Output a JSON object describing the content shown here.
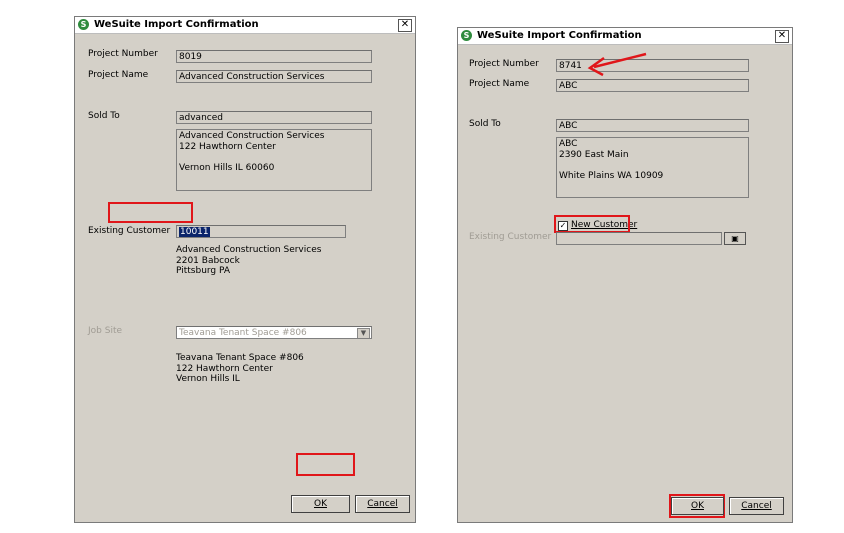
{
  "left": {
    "title": "WeSuite Import Confirmation",
    "close": "✕",
    "project_number_label": "Project Number",
    "project_number": "8019",
    "project_name_label": "Project Name",
    "project_name": "Advanced Construction Services",
    "sold_to_label": "Sold To",
    "sold_to": "advanced",
    "sold_to_address": [
      "Advanced Construction Services",
      "122 Hawthorn Center",
      "",
      "Vernon Hills IL 60060"
    ],
    "existing_customer_label": "Existing Customer",
    "existing_customer": "10011",
    "existing_customer_address": [
      "Advanced Construction Services",
      "2201 Babcock",
      "Pittsburg PA"
    ],
    "job_site_label": "Job Site",
    "job_site": "Teavana Tenant Space #806",
    "job_site_address": [
      "Teavana Tenant Space #806",
      "122 Hawthorn Center",
      "Vernon Hills IL"
    ],
    "ok": "OK",
    "cancel": "Cancel"
  },
  "right": {
    "title": "WeSuite Import Confirmation",
    "close": "✕",
    "project_number_label": "Project Number",
    "project_number": "8741",
    "project_name_label": "Project Name",
    "project_name": "ABC",
    "sold_to_label": "Sold To",
    "sold_to": "ABC",
    "sold_to_address": [
      "ABC",
      "2390 East Main",
      "",
      "White Plains WA 10909"
    ],
    "new_customer_label": "New Customer",
    "new_customer_checked": true,
    "existing_customer_label": "Existing Customer",
    "existing_customer": "",
    "ok": "OK",
    "cancel": "Cancel"
  },
  "colors": {
    "annotation": "#e0161a",
    "dialog_bg": "#d4d0c8",
    "title_icon": "#2e8b3d"
  },
  "icons": {
    "app": "wesuite-logo-icon",
    "close": "close-icon",
    "lookup": "lookup-icon",
    "dropdown": "chevron-down-icon",
    "annotation_arrow": "red-arrow-icon"
  }
}
